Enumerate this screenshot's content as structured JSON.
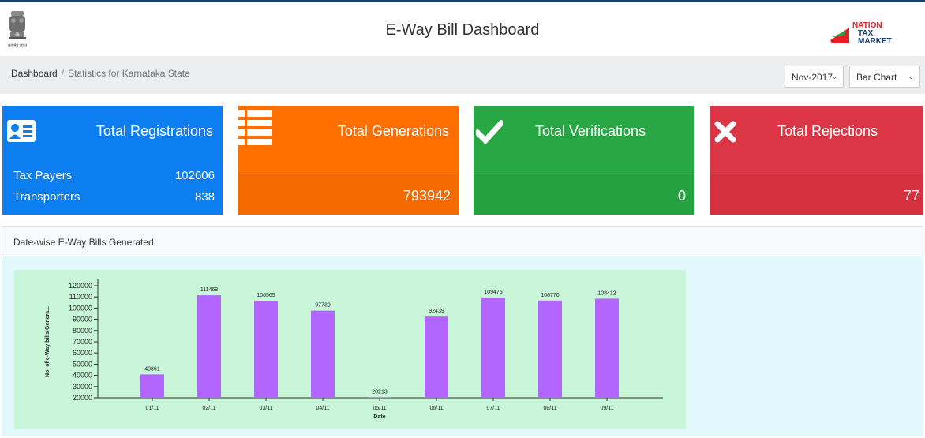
{
  "header": {
    "title": "E-Way Bill Dashboard",
    "emblem_caption": "सत्यमेव जयते",
    "brand_logo": {
      "line1": "NATION",
      "line2": "TAX",
      "line3": "MARKET",
      "colors": {
        "red": "#e31e24",
        "green": "#2e9e44",
        "navy": "#1b3f6b"
      }
    }
  },
  "breadcrumb": {
    "home": "Dashboard",
    "separator": "/",
    "current": "Statistics for Karnataka State"
  },
  "filters": {
    "month": "Nov-2017",
    "chart_type": "Bar Chart"
  },
  "cards": [
    {
      "title": "Total Registrations",
      "icon": "id-card-icon",
      "color": "#0d7ef2",
      "rows": [
        {
          "label": "Tax Payers",
          "value": "102606"
        },
        {
          "label": "Transporters",
          "value": "838"
        }
      ]
    },
    {
      "title": "Total Generations",
      "icon": "list-icon",
      "color": "#ff6f00",
      "value": "793942"
    },
    {
      "title": "Total Verifications",
      "icon": "checkmark-icon",
      "color": "#28a745",
      "value": "0"
    },
    {
      "title": "Total Rejections",
      "icon": "x-icon",
      "color": "#dc3545",
      "value": "77"
    }
  ],
  "panel": {
    "title": "Date-wise E-Way Bills Generated"
  },
  "chart_data": {
    "type": "bar",
    "categories": [
      "01/11",
      "02/11",
      "03/11",
      "04/11",
      "05/11",
      "06/11",
      "07/11",
      "08/11",
      "09/11"
    ],
    "values": [
      40861,
      111468,
      106565,
      97739,
      20213,
      92439,
      109475,
      106770,
      108412
    ],
    "xlabel": "Date",
    "ylabel": "No. of e-Way bills Genera...",
    "ylim": [
      20000,
      120000
    ],
    "yticks": [
      20000,
      30000,
      40000,
      50000,
      60000,
      70000,
      80000,
      90000,
      100000,
      110000,
      120000
    ],
    "bar_color": "#b266ff",
    "background_color": "#c9f6d9",
    "grid": false
  }
}
